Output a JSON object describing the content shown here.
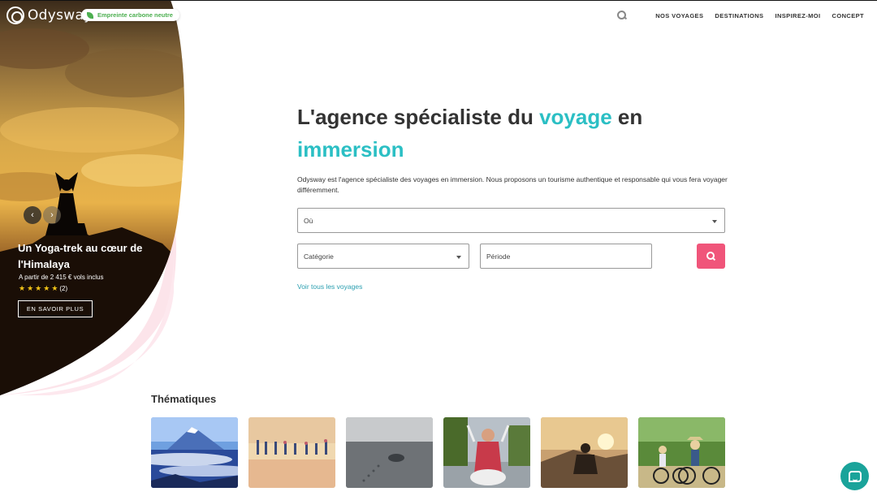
{
  "brand": {
    "name": "Odysway",
    "badge": "Empreinte carbone neutre"
  },
  "nav": {
    "items": [
      "NOS VOYAGES",
      "DESTINATIONS",
      "INSPIREZ-MOI",
      "CONCEPT"
    ]
  },
  "slide": {
    "title": "Un Yoga-trek au cœur de l'Himalaya",
    "price": "A partir de 2 415 € vols inclus",
    "stars": 5,
    "review_count": "(2)",
    "cta": "EN SAVOIR PLUS"
  },
  "hero": {
    "headline_part1": "L'agence spécialiste du ",
    "headline_accent1": "voyage",
    "headline_part2": " en",
    "headline_accent2": "immersion",
    "intro": "Odysway est l'agence spécialiste des voyages en immersion. Nous proposons un tourisme authentique et responsable qui vous fera voyager différemment."
  },
  "search": {
    "where": "Où",
    "category": "Catégorie",
    "period": "Période",
    "all_link": "Voir tous les voyages"
  },
  "themes": {
    "title": "Thématiques"
  },
  "colors": {
    "accent": "#2bbfc4",
    "search_button": "#f0557a",
    "chat": "#1aa39a"
  }
}
